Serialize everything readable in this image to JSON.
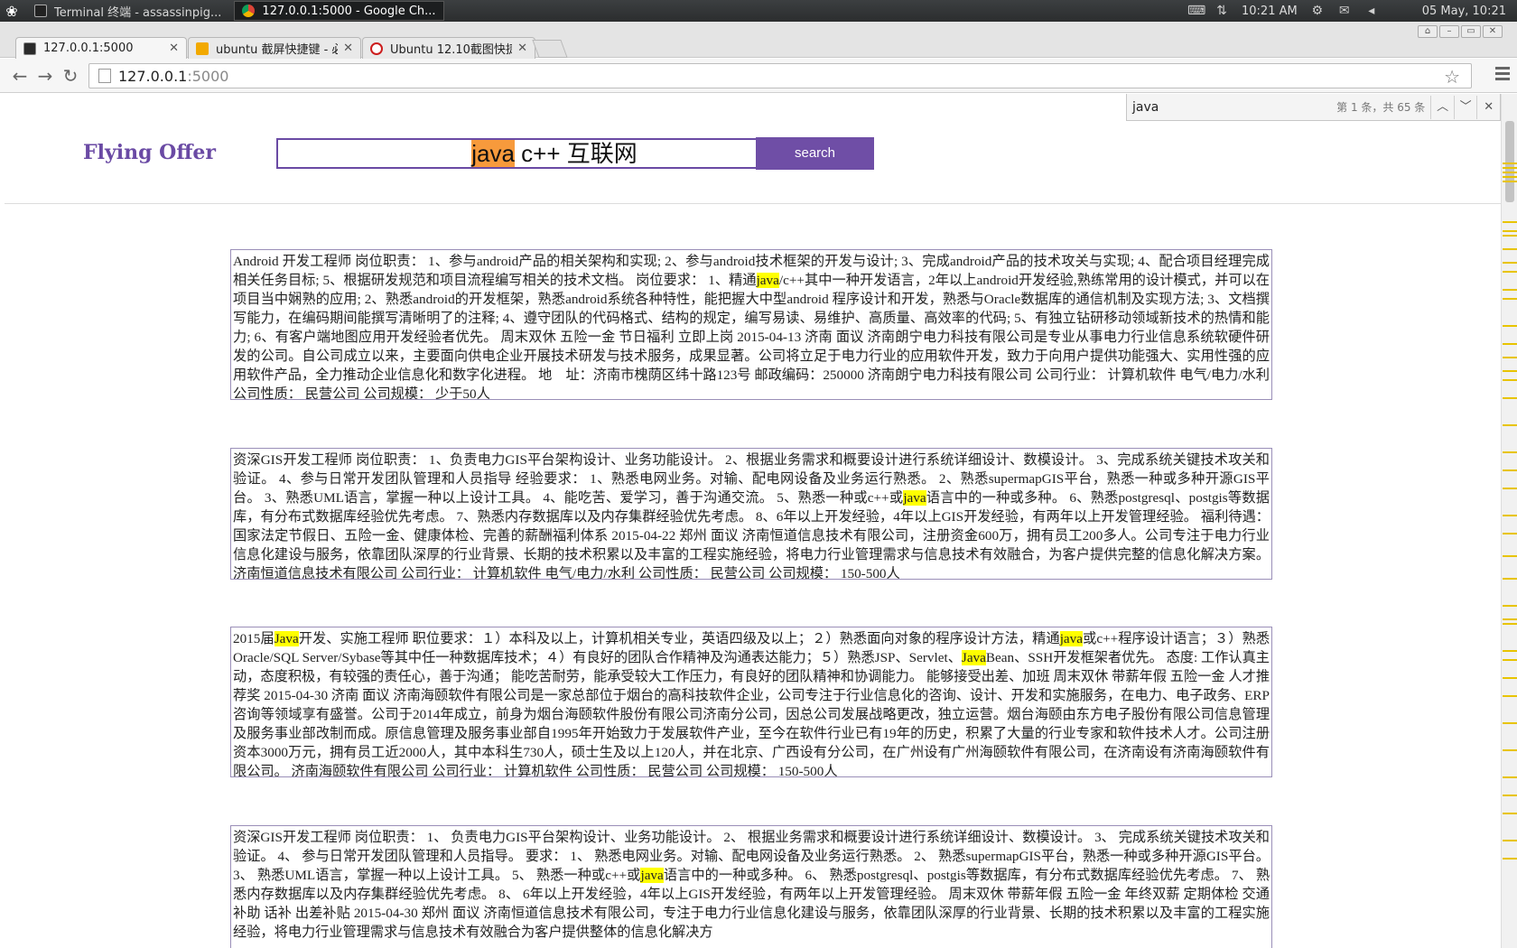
{
  "system_panel": {
    "tasks": [
      {
        "label": "Terminal 终端 - assassinpig...",
        "icon": "terminal-icon",
        "active": false
      },
      {
        "label": "127.0.0.1:5000 - Google Ch...",
        "icon": "chrome-icon",
        "active": true
      }
    ],
    "clock": "10:21 AM",
    "date": "05 May, 10:21"
  },
  "browser": {
    "tabs": [
      {
        "label": "127.0.0.1:5000",
        "favicon": "page-icon",
        "active": true
      },
      {
        "label": "ubuntu 截屏快捷键 - 必",
        "favicon": "bing-icon",
        "active": false
      },
      {
        "label": "Ubuntu 12.10截图快捷键",
        "favicon": "baidu-icon",
        "active": false
      }
    ],
    "url_host": "127.0.0.1",
    "url_port": ":5000"
  },
  "find_bar": {
    "query": "java",
    "count": "第 1 条，共 65 条"
  },
  "page": {
    "brand": "Flying Offer",
    "search_value": {
      "hl": "java",
      "rest": " c++ 互联网"
    },
    "search_button": "search",
    "results": [
      [
        {
          "t": "Android 开发工程师 岗位职责： 1、参与android产品的相关架构和实现; 2、参与android技术框架的开发与设计; 3、完成android产品的技术攻关与实现; 4、配合项目经理完成相关任务目标; 5、根据研发规范和项目流程编写相关的技术文档。 岗位要求： 1、精通"
        },
        {
          "t": "java",
          "hl": true
        },
        {
          "t": "/c++其中一种开发语言，2年以上android开发经验,熟练常用的设计模式，并可以在项目当中娴熟的应用; 2、熟悉android的开发框架，熟悉android系统各种特性，能把握大中型android 程序设计和开发，熟悉与Oracle数据库的通信机制及实现方法; 3、文档撰写能力，在编码期间能撰写清晰明了的注释; 4、遵守团队的代码格式、结构的规定，编写易读、易维护、高质量、高效率的代码; 5、有独立钻研移动领域新技术的热情和能力; 6、有客户端地图应用开发经验者优先。 周末双休 五险一金 节日福利 立即上岗 2015-04-13 济南 面议 济南朗宁电力科技有限公司是专业从事电力行业信息系统软硬件研发的公司。自公司成立以来，主要面向供电企业开展技术研发与技术服务，成果显著。公司将立足于电力行业的应用软件开发，致力于向用户提供功能强大、实用性强的应用软件产品，全力推动企业信息化和数字化进程。 地　址：济南市槐荫区纬十路123号 邮政编码：250000 济南朗宁电力科技有限公司 公司行业： 计算机软件  电气/电力/水利 公司性质： 民营公司 公司规模： 少于50人"
        }
      ],
      [
        {
          "t": "资深GIS开发工程师 岗位职责： 1、负责电力GIS平台架构设计、业务功能设计。 2、根据业务需求和概要设计进行系统详细设计、数模设计。 3、完成系统关键技术攻关和验证。 4、参与日常开发团队管理和人员指导 经验要求： 1、熟悉电网业务。对输、配电网设备及业务运行熟悉。 2、熟悉supermapGIS平台，熟悉一种或多种开源GIS平台。 3、熟悉UML语言，掌握一种以上设计工具。 4、能吃苦、爱学习，善于沟通交流。 5、熟悉一种或c++或"
        },
        {
          "t": "java",
          "hl": true
        },
        {
          "t": "语言中的一种或多种。 6、熟悉postgresql、postgis等数据库，有分布式数据库经验优先考虑。 7、熟悉内存数据库以及内存集群经验优先考虑。 8、6年以上开发经验，4年以上GIS开发经验，有两年以上开发管理经验。 福利待遇： 国家法定节假日、五险一金、健康体检、完善的薪酬福利体系 2015-04-22 郑州 面议 济南恒道信息技术有限公司，注册资金600万，拥有员工200多人。公司专注于电力行业信息化建设与服务，依靠团队深厚的行业背景、长期的技术积累以及丰富的工程实施经验，将电力行业管理需求与信息技术有效融合，为客户提供完整的信息化解决方案。 济南恒道信息技术有限公司 公司行业： 计算机软件  电气/电力/水利 公司性质： 民营公司 公司规模： 150-500人"
        }
      ],
      [
        {
          "t": "2015届"
        },
        {
          "t": "Java",
          "hl": true
        },
        {
          "t": "开发、实施工程师 职位要求：１）本科及以上，计算机相关专业，英语四级及以上；２）熟悉面向对象的程序设计方法，精通"
        },
        {
          "t": "java",
          "hl": true
        },
        {
          "t": "或c++程序设计语言；３）熟悉Oracle/SQL Server/Sybase等其中任一种数据库技术；４）有良好的团队合作精神及沟通表达能力；５）熟悉JSP、Servlet、"
        },
        {
          "t": "Java",
          "hl": true
        },
        {
          "t": "Bean、SSH开发框架者优先。 态度: 工作认真主动，态度积极，有较强的责任心，善于沟通； 能吃苦耐劳，能承受较大工作压力，有良好的团队精神和协调能力。 能够接受出差、加班 周末双休 带薪年假 五险一金 人才推荐奖 2015-04-30 济南 面议 济南海颐软件有限公司是一家总部位于烟台的高科技软件企业，公司专注于行业信息化的咨询、设计、开发和实施服务，在电力、电子政务、ERP咨询等领域享有盛誉。公司于2014年成立，前身为烟台海颐软件股份有限公司济南分公司，因总公司发展战略更改，独立运营。烟台海颐由东方电子股份有限公司信息管理及服务事业部改制而成。原信息管理及服务事业部自1995年开始致力于发展软件产业，至今在软件行业已有19年的历史，积累了大量的行业专家和软件技术人才。公司注册资本3000万元，拥有员工近2000人，其中本科生730人，硕士生及以上120人，并在北京、广西设有分公司，在广州设有广州海颐软件有限公司，在济南设有济南海颐软件有限公司。 济南海颐软件有限公司 公司行业： 计算机软件 公司性质： 民营公司 公司规模： 150-500人"
        }
      ],
      [
        {
          "t": "资深GIS开发工程师 岗位职责： 1、 负责电力GIS平台架构设计、业务功能设计。 2、 根据业务需求和概要设计进行系统详细设计、数模设计。 3、 完成系统关键技术攻关和验证。 4、 参与日常开发团队管理和人员指导。 要求： 1、 熟悉电网业务。对输、配电网设备及业务运行熟悉。 2、 熟悉supermapGIS平台，熟悉一种或多种开源GIS平台。 3、 熟悉UML语言，掌握一种以上设计工具。 5、 熟悉一种或c++或"
        },
        {
          "t": "java",
          "hl": true
        },
        {
          "t": "语言中的一种或多种。 6、 熟悉postgresql、postgis等数据库，有分布式数据库经验优先考虑。 7、 熟悉内存数据库以及内存集群经验优先考虑。 8、 6年以上开发经验，4年以上GIS开发经验，有两年以上开发管理经验。 周末双休 带薪年假 五险一金 年终双薪 定期体检 交通补助 话补 出差补贴 2015-04-30 郑州 面议 济南恒道信息技术有限公司，专注于电力行业信息化建设与服务，依靠团队深厚的行业背景、长期的技术积累以及丰富的工程实施经验，将电力行业管理需求与信息技术有效融合为客户提供整体的信息化解决方"
        }
      ]
    ]
  }
}
